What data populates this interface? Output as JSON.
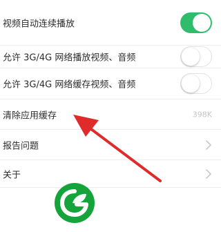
{
  "settings": {
    "autoplay_label": "视频自动连续播放",
    "cellular_play_label": "允许 3G/4G 网络播放视频、音频",
    "cellular_cache_label": "允许 3G/4G 网络缓存视频、音频",
    "clear_cache_label": "清除应用缓存",
    "cache_size": "398K",
    "report_label": "报告问题",
    "about_label": "关于"
  },
  "toggles": {
    "autoplay": true,
    "cellular_play": false,
    "cellular_cache": false
  },
  "colors": {
    "toggle_on": "#2fbd6c",
    "arrow": "#e02b2b",
    "logo_green": "#15a43c"
  },
  "icons": {
    "chevron": "chevron-right-icon",
    "logo": "leaf-logo-icon"
  }
}
